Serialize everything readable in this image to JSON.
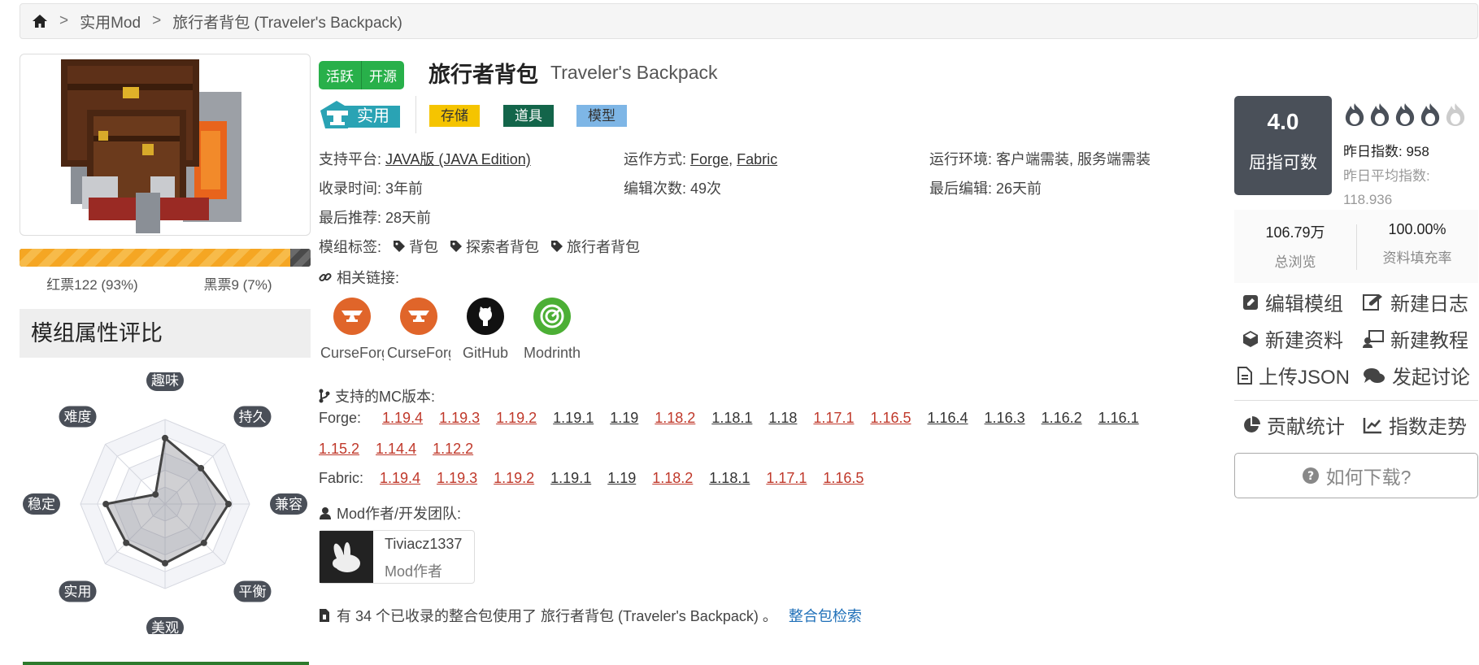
{
  "breadcrumb": {
    "home_icon": "home-icon",
    "items": [
      "实用Mod",
      "旅行者背包 (Traveler's Backpack)"
    ]
  },
  "mod": {
    "status": [
      "活跃",
      "开源"
    ],
    "title_cn": "旅行者背包",
    "title_en": "Traveler's Backpack",
    "category": "实用",
    "tags": [
      {
        "label": "存储",
        "bg": "#f5c400",
        "fg": "#333333"
      },
      {
        "label": "道具",
        "bg": "#13654a",
        "fg": "#ffffff"
      },
      {
        "label": "模型",
        "bg": "#7eb6e6",
        "fg": "#333333"
      }
    ],
    "info": {
      "platform_label": "支持平台:",
      "platform": "JAVA版 (JAVA Edition)",
      "run_label": "运作方式:",
      "run_forge": "Forge",
      "run_sep": ",",
      "run_fabric": "Fabric",
      "env_label": "运行环境:",
      "env": "客户端需装, 服务端需装",
      "added": "收录时间: 3年前",
      "edits": "编辑次数: 49次",
      "last_edit": "最后编辑: 26天前",
      "last_rec": "最后推荐: 28天前"
    },
    "modtags_label": "模组标签:",
    "modtags": [
      "背包",
      "探索者背包",
      "旅行者背包"
    ],
    "links_label": "相关链接:",
    "links": [
      {
        "label": "CurseForge",
        "icon": "curseforge-icon",
        "color": "#e0652a"
      },
      {
        "label": "CurseForge",
        "icon": "curseforge-icon",
        "color": "#e0652a"
      },
      {
        "label": "GitHub",
        "icon": "github-icon",
        "color": "#111111"
      },
      {
        "label": "Modrinth",
        "icon": "modrinth-icon",
        "color": "#4caf35"
      }
    ],
    "versions_label": "支持的MC版本:",
    "forge_label": "Forge:",
    "forge_versions": [
      {
        "v": "1.19.4",
        "hl": true
      },
      {
        "v": "1.19.3",
        "hl": true
      },
      {
        "v": "1.19.2",
        "hl": true
      },
      {
        "v": "1.19.1",
        "hl": false
      },
      {
        "v": "1.19",
        "hl": false
      },
      {
        "v": "1.18.2",
        "hl": true
      },
      {
        "v": "1.18.1",
        "hl": false
      },
      {
        "v": "1.18",
        "hl": false
      },
      {
        "v": "1.17.1",
        "hl": true
      },
      {
        "v": "1.16.5",
        "hl": true
      },
      {
        "v": "1.16.4",
        "hl": false
      },
      {
        "v": "1.16.3",
        "hl": false
      },
      {
        "v": "1.16.2",
        "hl": false
      },
      {
        "v": "1.16.1",
        "hl": false
      },
      {
        "v": "1.15.2",
        "hl": true
      },
      {
        "v": "1.14.4",
        "hl": true
      },
      {
        "v": "1.12.2",
        "hl": true
      }
    ],
    "fabric_label": "Fabric:",
    "fabric_versions": [
      {
        "v": "1.19.4",
        "hl": true
      },
      {
        "v": "1.19.3",
        "hl": true
      },
      {
        "v": "1.19.2",
        "hl": true
      },
      {
        "v": "1.19.1",
        "hl": false
      },
      {
        "v": "1.19",
        "hl": false
      },
      {
        "v": "1.18.2",
        "hl": true
      },
      {
        "v": "1.18.1",
        "hl": false
      },
      {
        "v": "1.17.1",
        "hl": true
      },
      {
        "v": "1.16.5",
        "hl": true
      }
    ],
    "author_label": "Mod作者/开发团队:",
    "author": {
      "name": "Tiviacz1337",
      "role": "Mod作者"
    },
    "modpack_text": "有 34 个已收录的整合包使用了 旅行者背包 (Traveler's Backpack) 。",
    "modpack_link": "整合包检索"
  },
  "votes": {
    "red_label": "红票122 (93%)",
    "black_label": "黑票9 (7%)",
    "red_fraction": 0.93
  },
  "attributes": {
    "title": "模组属性评比",
    "axes": [
      "趣味",
      "持久",
      "兼容",
      "平衡",
      "美观",
      "实用",
      "稳定",
      "难度"
    ],
    "values": [
      0.78,
      0.6,
      0.75,
      0.65,
      0.7,
      0.65,
      0.7,
      0.16
    ]
  },
  "rating": {
    "score": "4.0",
    "score_label": "屈指可数",
    "flames_filled": 4,
    "flames_total": 5,
    "yesterday": "昨日指数: 958",
    "yesterday_avg_label": "昨日平均指数:",
    "yesterday_avg": "118.936"
  },
  "stats": {
    "views": "106.79万",
    "views_label": "总浏览",
    "fill": "100.00%",
    "fill_label": "资料填充率"
  },
  "actions": {
    "edit": "编辑模组",
    "new_log": "新建日志",
    "new_info": "新建资料",
    "new_tutorial": "新建教程",
    "upload_json": "上传JSON",
    "discuss": "发起讨论",
    "contrib": "贡献统计",
    "trend": "指数走势",
    "how_download": "如何下载?"
  }
}
